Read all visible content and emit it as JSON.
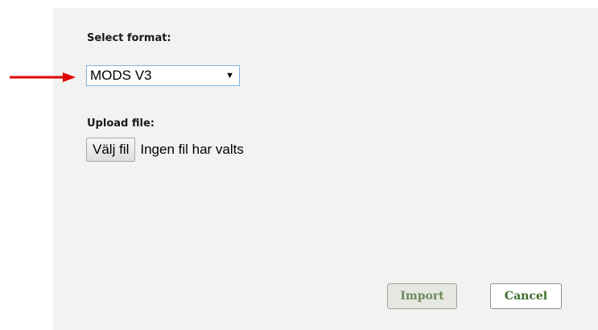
{
  "annotation": {
    "arrow_color": "#e00000"
  },
  "form": {
    "format_label": "Select format:",
    "format_selected": "MODS V3",
    "upload_label": "Upload file:",
    "file_button_label": "Välj fil",
    "file_status": "Ingen fil har valts"
  },
  "actions": {
    "import_label": "Import",
    "cancel_label": "Cancel"
  },
  "colors": {
    "panel_bg": "#f2f2f2",
    "button_text": "#3c6e2a",
    "select_border": "#7eb4ea"
  }
}
